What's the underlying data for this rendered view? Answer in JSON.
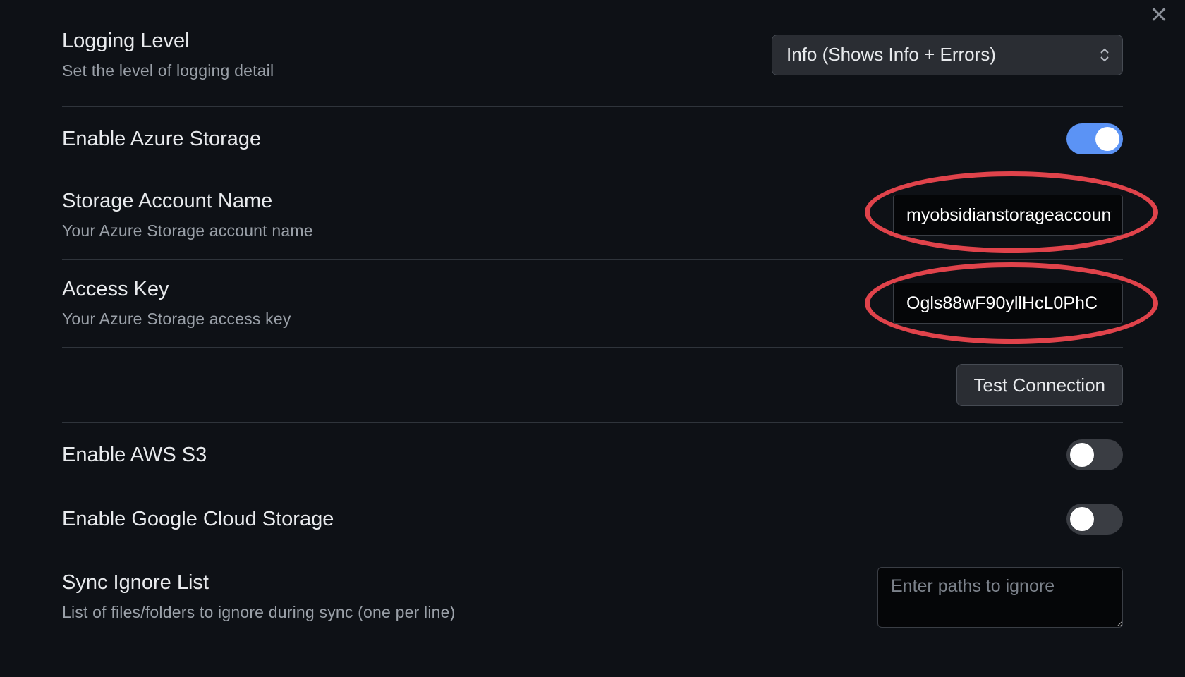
{
  "close_icon": "close-icon",
  "settings": {
    "logging": {
      "name": "Logging Level",
      "desc": "Set the level of logging detail",
      "selected": "Info (Shows Info + Errors)"
    },
    "azure": {
      "name": "Enable Azure Storage",
      "enabled": true
    },
    "account": {
      "name": "Storage Account Name",
      "desc": "Your Azure Storage account name",
      "value": "myobsidianstorageaccount"
    },
    "access_key": {
      "name": "Access Key",
      "desc": "Your Azure Storage access key",
      "value": "Ogls88wF90yllHcL0PhC"
    },
    "test_connection": {
      "label": "Test Connection"
    },
    "aws": {
      "name": "Enable AWS S3",
      "enabled": false
    },
    "gcs": {
      "name": "Enable Google Cloud Storage",
      "enabled": false
    },
    "ignore": {
      "name": "Sync Ignore List",
      "desc": "List of files/folders to ignore during sync (one per line)",
      "placeholder": "Enter paths to ignore"
    }
  },
  "colors": {
    "background": "#0e1116",
    "toggle_on": "#5b93f5",
    "annotation": "#e0434b"
  }
}
